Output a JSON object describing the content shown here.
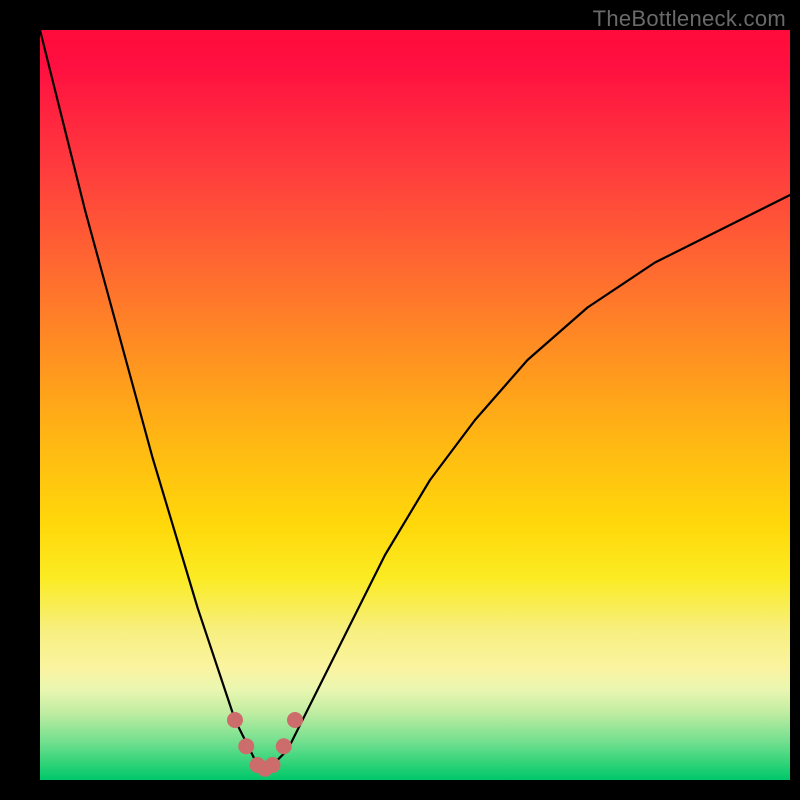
{
  "watermark": "TheBottleneck.com",
  "chart_data": {
    "type": "line",
    "title": "",
    "xlabel": "",
    "ylabel": "",
    "xlim": [
      0,
      100
    ],
    "ylim": [
      0,
      100
    ],
    "gradient_stops": [
      {
        "pct": 0,
        "color": "#ff0b3b"
      },
      {
        "pct": 18,
        "color": "#ff3a3e"
      },
      {
        "pct": 32,
        "color": "#ff6a30"
      },
      {
        "pct": 44,
        "color": "#ff9320"
      },
      {
        "pct": 55,
        "color": "#ffb813"
      },
      {
        "pct": 66,
        "color": "#ffd80a"
      },
      {
        "pct": 80,
        "color": "#faf4a0"
      },
      {
        "pct": 91,
        "color": "#c0eda2"
      },
      {
        "pct": 100,
        "color": "#00c76a"
      }
    ],
    "series": [
      {
        "name": "bottleneck-curve",
        "color": "#000000",
        "x": [
          0,
          3,
          6,
          9,
          12,
          15,
          18,
          21,
          24,
          26,
          28,
          29,
          30,
          31,
          33,
          35,
          38,
          42,
          46,
          52,
          58,
          65,
          73,
          82,
          92,
          100
        ],
        "y": [
          100,
          88,
          76,
          65,
          54,
          43,
          33,
          23,
          14,
          8,
          4,
          2,
          1,
          2,
          4,
          8,
          14,
          22,
          30,
          40,
          48,
          56,
          63,
          69,
          74,
          78
        ]
      }
    ],
    "markers": {
      "name": "valley-markers",
      "color": "#cc6d6b",
      "radius_px": 8,
      "points": [
        {
          "x": 26.0,
          "y": 8.0
        },
        {
          "x": 27.5,
          "y": 4.5
        },
        {
          "x": 29.0,
          "y": 2.0
        },
        {
          "x": 30.0,
          "y": 1.5
        },
        {
          "x": 31.0,
          "y": 2.0
        },
        {
          "x": 32.5,
          "y": 4.5
        },
        {
          "x": 34.0,
          "y": 8.0
        }
      ]
    }
  }
}
